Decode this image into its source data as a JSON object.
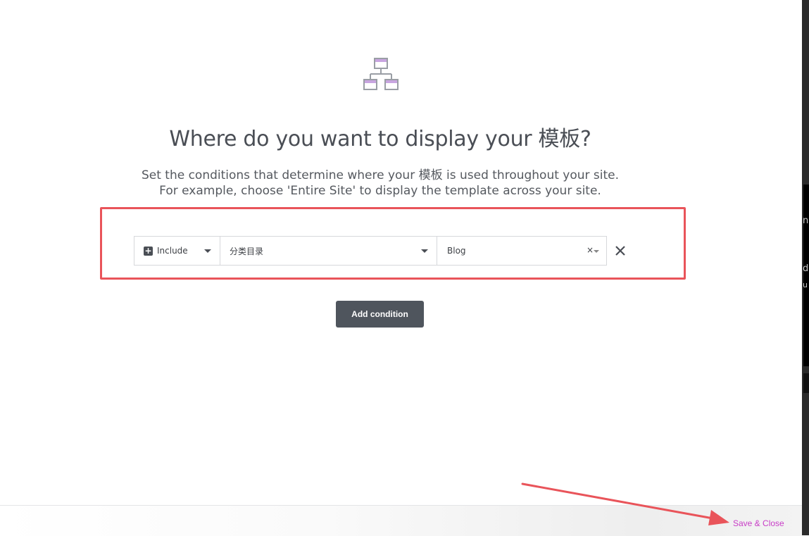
{
  "header": {
    "icon": "sitemap-icon",
    "title": "Where do you want to display your 模板?",
    "description_line1": "Set the conditions that determine where your 模板 is used throughout your site.",
    "description_line2": "For example, choose 'Entire Site' to display the template across your site."
  },
  "condition": {
    "type_label": "Include",
    "type_icon": "plus-icon",
    "subtype_label": "分类目录",
    "value_label": "Blog",
    "clear_symbol": "×",
    "remove_icon": "close-icon"
  },
  "actions": {
    "add_condition_label": "Add condition",
    "save_close_label": "Save & Close"
  },
  "annotations": {
    "highlight_color": "#e9545a",
    "arrow_color": "#e9545a"
  },
  "colors": {
    "accent": "#c83dc7",
    "icon_purple": "#c8a5e0",
    "button_bg": "#4f555d",
    "title_text": "#4a4e55"
  },
  "right_edge": {
    "glyph_1": "n",
    "glyph_2": "d",
    "glyph_3": "u"
  }
}
